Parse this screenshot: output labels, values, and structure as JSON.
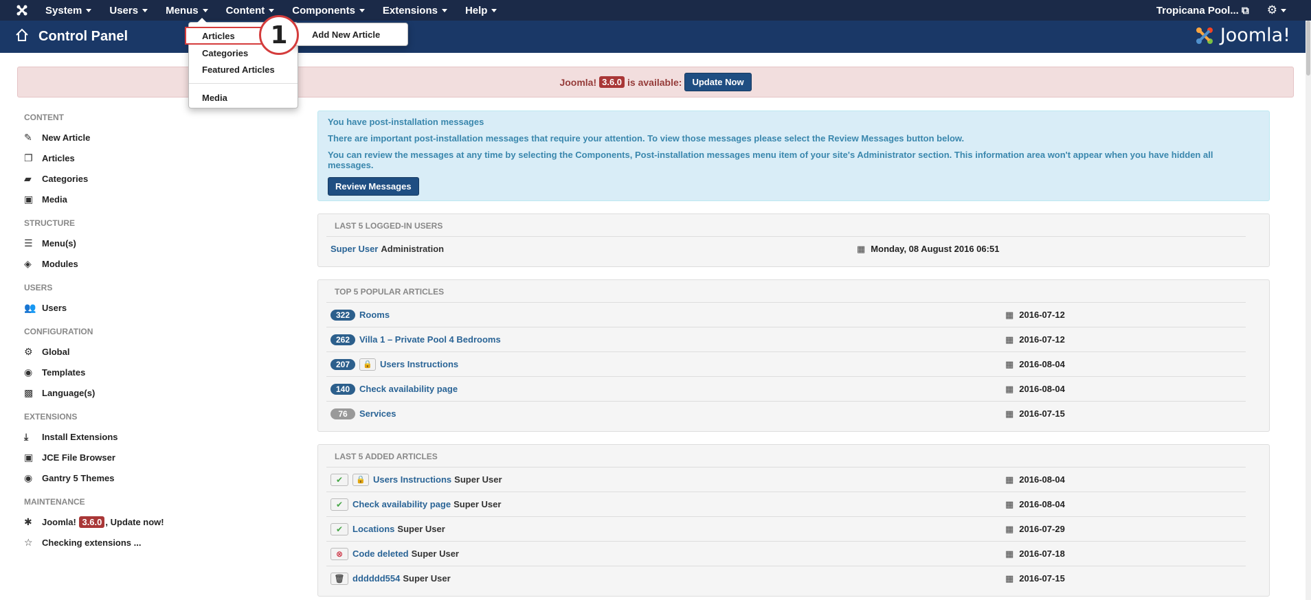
{
  "topnav": {
    "menus": [
      "System",
      "Users",
      "Menus",
      "Content",
      "Components",
      "Extensions",
      "Help"
    ],
    "site_label": "Tropicana Pool..."
  },
  "header": {
    "title": "Control Panel",
    "brand": "Joomla!"
  },
  "content_menu": {
    "items": [
      "Articles",
      "Categories",
      "Featured Articles",
      "Media"
    ],
    "submenu": "Add New Article",
    "callout_number": "1"
  },
  "update_alert": {
    "prefix": "Joomla!",
    "version": "3.6.0",
    "suffix": "is available:",
    "button": "Update Now"
  },
  "sidebar": {
    "sections": [
      {
        "title": "CONTENT",
        "items": [
          {
            "label": "New Article",
            "icon": "pencil-icon"
          },
          {
            "label": "Articles",
            "icon": "copy-icon"
          },
          {
            "label": "Categories",
            "icon": "folder-icon"
          },
          {
            "label": "Media",
            "icon": "image-icon"
          }
        ]
      },
      {
        "title": "STRUCTURE",
        "items": [
          {
            "label": "Menu(s)",
            "icon": "list-icon"
          },
          {
            "label": "Modules",
            "icon": "cube-icon"
          }
        ]
      },
      {
        "title": "USERS",
        "items": [
          {
            "label": "Users",
            "icon": "users-icon"
          }
        ]
      },
      {
        "title": "CONFIGURATION",
        "items": [
          {
            "label": "Global",
            "icon": "gear-icon"
          },
          {
            "label": "Templates",
            "icon": "eye-icon"
          },
          {
            "label": "Language(s)",
            "icon": "comments-icon"
          }
        ]
      },
      {
        "title": "EXTENSIONS",
        "items": [
          {
            "label": "Install Extensions",
            "icon": "download-icon"
          },
          {
            "label": "JCE File Browser",
            "icon": "image-icon"
          },
          {
            "label": "Gantry 5 Themes",
            "icon": "eye-icon"
          }
        ]
      },
      {
        "title": "MAINTENANCE",
        "items": [
          {
            "label": "Joomla! 3.6.0, Update now!",
            "icon": "joomla-icon"
          },
          {
            "label": "Checking extensions ...",
            "icon": "star-icon"
          }
        ]
      }
    ]
  },
  "postinstall": {
    "heading": "You have post-installation messages",
    "line1": "There are important post-installation messages that require your attention. To view those messages please select the Review Messages button below.",
    "line2": "You can review the messages at any time by selecting the Components, Post-installation messages menu item of your site's Administrator section. This information area won't appear when you have hidden all messages.",
    "button": "Review Messages"
  },
  "logged_users": {
    "title": "LAST 5 LOGGED-IN USERS",
    "rows": [
      {
        "user": "Super User",
        "area": "Administration",
        "date": "Monday, 08 August 2016 06:51"
      }
    ]
  },
  "popular": {
    "title": "TOP 5 POPULAR ARTICLES",
    "rows": [
      {
        "hits": "322",
        "title": "Rooms",
        "locked": false,
        "date": "2016-07-12"
      },
      {
        "hits": "262",
        "title": "Villa 1 – Private Pool 4 Bedrooms",
        "locked": false,
        "date": "2016-07-12"
      },
      {
        "hits": "207",
        "title": "Users Instructions",
        "locked": true,
        "date": "2016-08-04"
      },
      {
        "hits": "140",
        "title": "Check availability page",
        "locked": false,
        "date": "2016-08-04"
      },
      {
        "hits": "76",
        "title": "Services",
        "locked": false,
        "date": "2016-07-15"
      }
    ]
  },
  "added": {
    "title": "LAST 5 ADDED ARTICLES",
    "rows": [
      {
        "status": "published",
        "locked": true,
        "title": "Users Instructions",
        "author": "Super User",
        "date": "2016-08-04"
      },
      {
        "status": "published",
        "locked": false,
        "title": "Check availability page",
        "author": "Super User",
        "date": "2016-08-04"
      },
      {
        "status": "published",
        "locked": false,
        "title": "Locations",
        "author": "Super User",
        "date": "2016-07-29"
      },
      {
        "status": "unpublished",
        "locked": false,
        "title": "Code deleted",
        "author": "Super User",
        "date": "2016-07-18"
      },
      {
        "status": "trashed",
        "locked": false,
        "title": "dddddd554",
        "author": "Super User",
        "date": "2016-07-15"
      }
    ]
  }
}
